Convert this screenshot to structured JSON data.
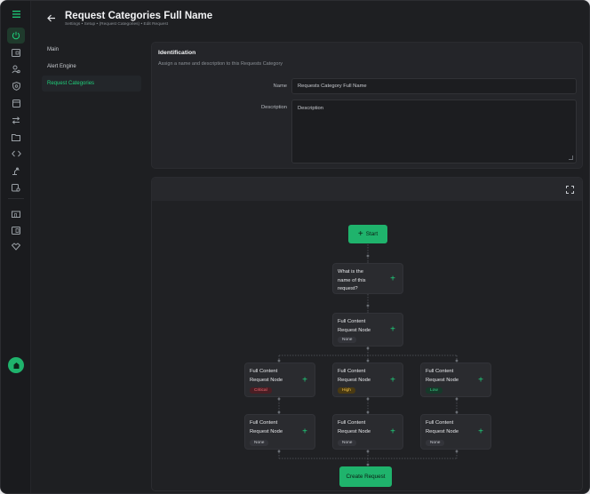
{
  "header": {
    "title": "Request Categories Full Name",
    "breadcrumb": "Settings • Setup • (Request Categories) • Edit Request"
  },
  "subnav": {
    "items": [
      {
        "label": "Main"
      },
      {
        "label": "Alert Engine"
      },
      {
        "label": "Request Categories"
      }
    ]
  },
  "identification": {
    "title": "Identification",
    "subtitle": "Assign a name and description to this Requests Category",
    "name_label": "Name",
    "name_value": "Requests Category Full Name",
    "description_label": "Description",
    "description_placeholder": "Description"
  },
  "flow": {
    "start_label": "Start",
    "question_node": "What is the\nname of this\nrequest?",
    "content_node": "Full Content\nRequest Node",
    "none_badge": "None",
    "critical_badge": "Critical",
    "high_badge": "High",
    "low_badge": "Low",
    "create_label": "Create Request"
  },
  "colors": {
    "accent": "#1fb36c",
    "background": "#1e1f22",
    "panel": "#242529"
  }
}
